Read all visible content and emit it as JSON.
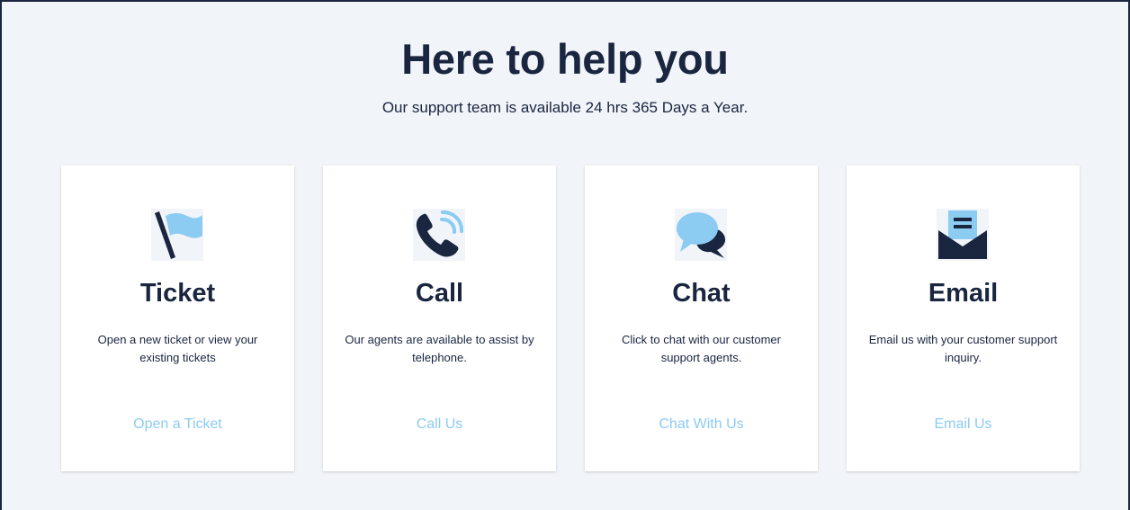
{
  "header": {
    "title": "Here to help you",
    "subtitle": "Our support team is available 24 hrs 365 Days a Year."
  },
  "cards": [
    {
      "icon": "flag-icon",
      "title": "Ticket",
      "description": "Open a new ticket or view your existing tickets",
      "link": "Open a Ticket"
    },
    {
      "icon": "phone-icon",
      "title": "Call",
      "description": "Our agents are available to assist by telephone.",
      "link": "Call Us"
    },
    {
      "icon": "chat-bubbles-icon",
      "title": "Chat",
      "description": "Click to chat with our customer support agents.",
      "link": "Chat With Us"
    },
    {
      "icon": "envelope-icon",
      "title": "Email",
      "description": "Email us with your customer support inquiry.",
      "link": "Email Us"
    }
  ],
  "colors": {
    "navy": "#1a2540",
    "accent_blue": "#8ccbf2",
    "background": "#f1f4f8",
    "card": "#ffffff"
  }
}
